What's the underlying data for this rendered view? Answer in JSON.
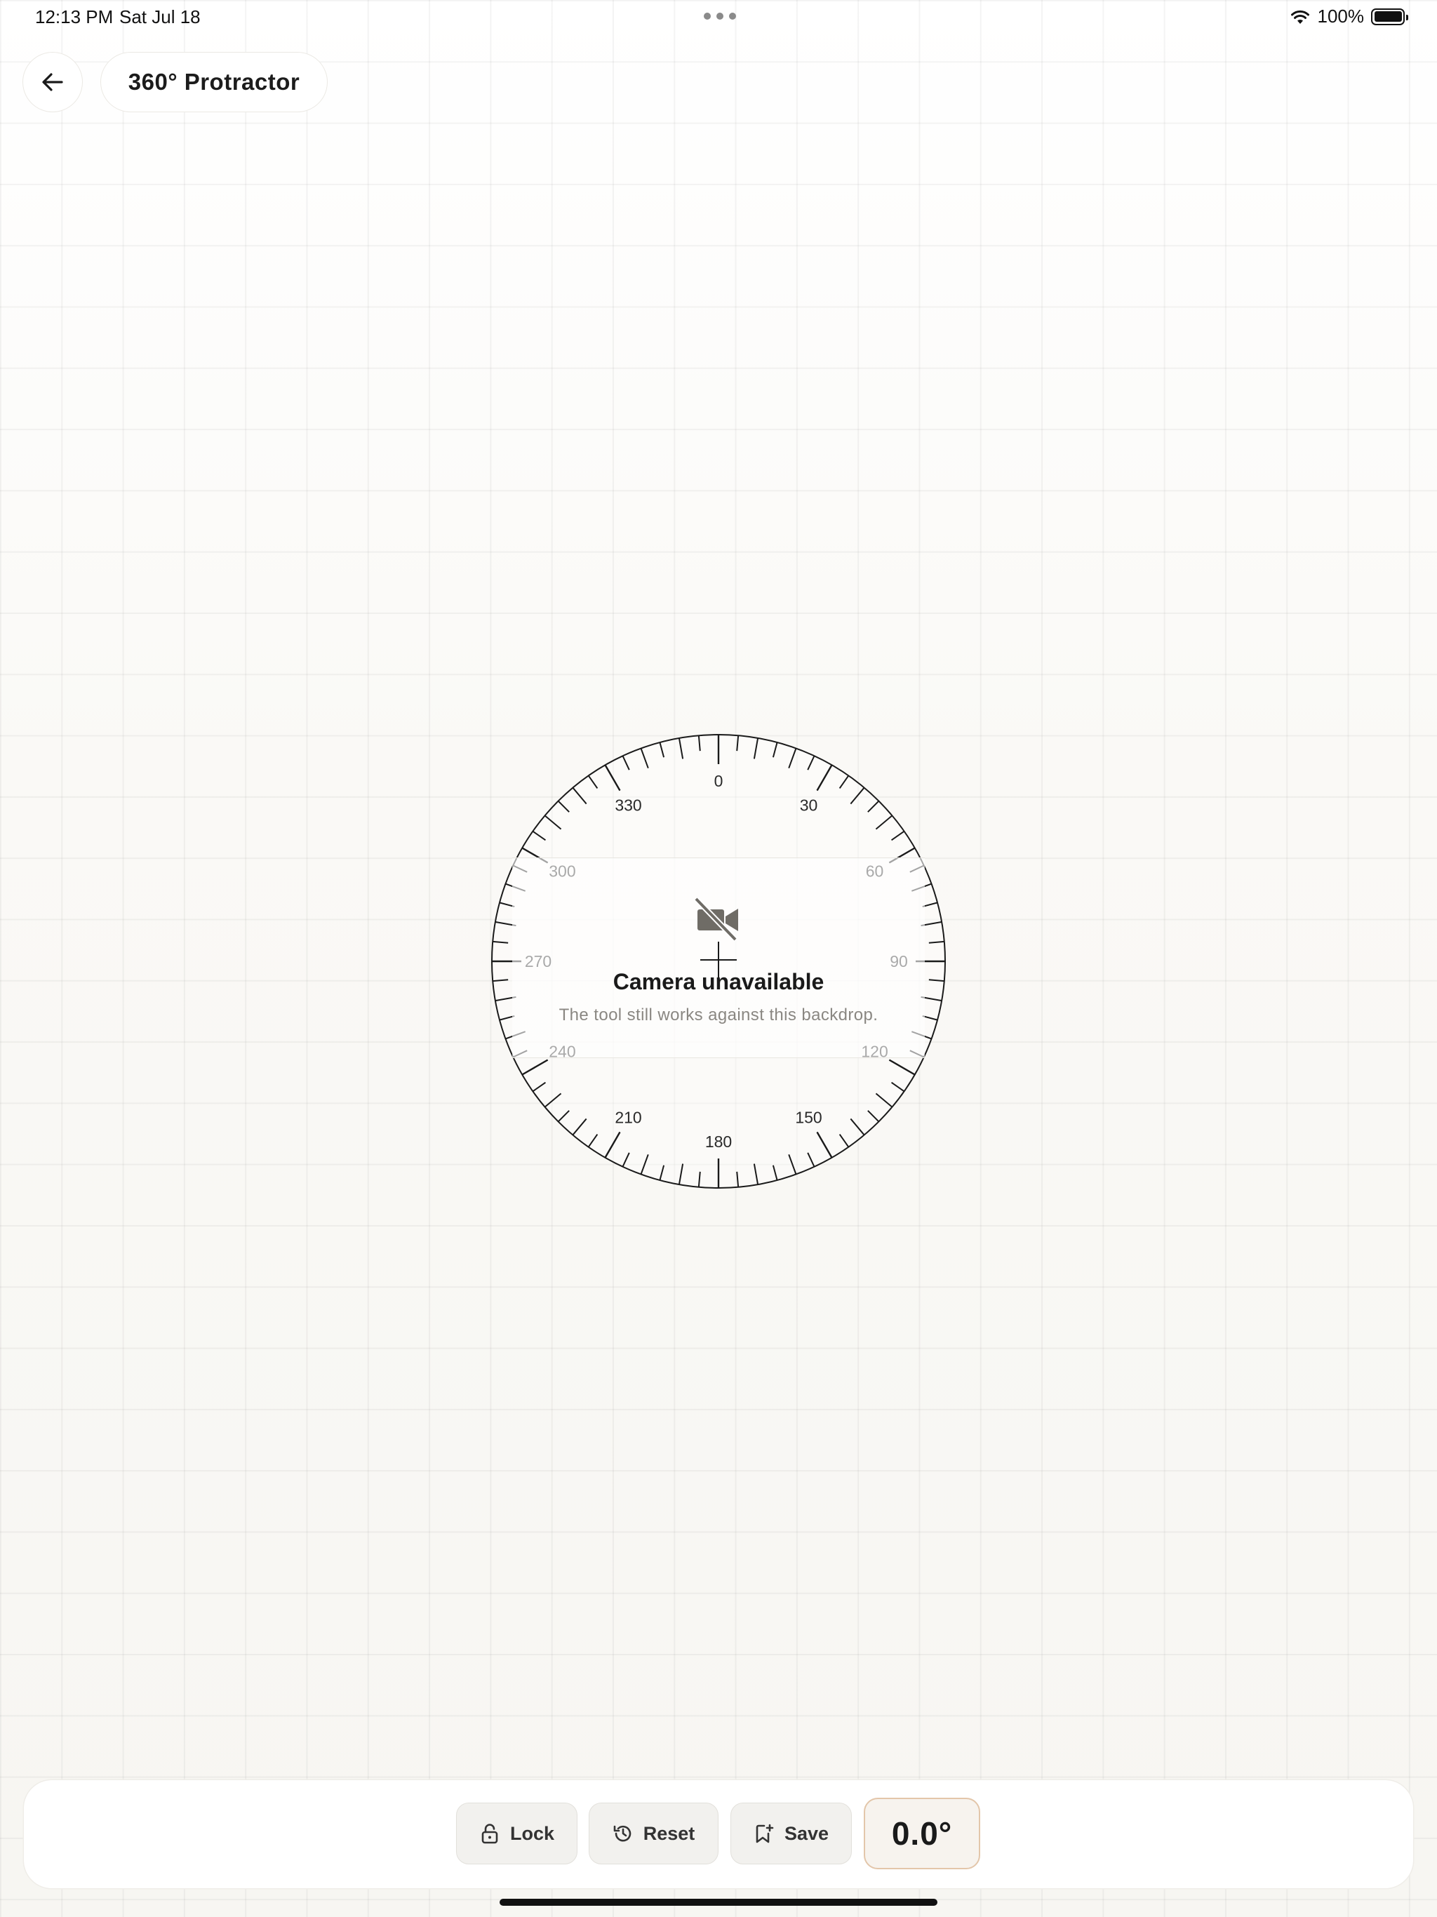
{
  "status_bar": {
    "time": "12:13 PM",
    "date": "Sat Jul 18",
    "battery": "100%"
  },
  "header": {
    "title": "360° Protractor"
  },
  "protractor": {
    "labels": [
      "0",
      "30",
      "60",
      "90",
      "120",
      "150",
      "180",
      "210",
      "240",
      "270",
      "300",
      "330"
    ],
    "tick_color": "#1a1a1a"
  },
  "camera_notice": {
    "title": "Camera unavailable",
    "subtitle": "The tool still works against this backdrop."
  },
  "toolbar": {
    "lock_label": "Lock",
    "reset_label": "Reset",
    "save_label": "Save",
    "angle_value": "0.0°",
    "accent_color": "#e3c6aa"
  }
}
